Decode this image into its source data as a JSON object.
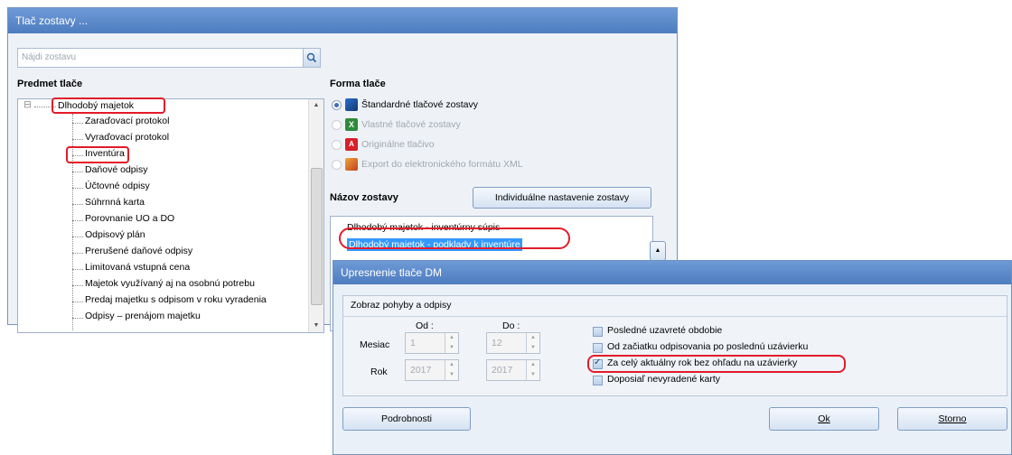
{
  "window": {
    "title": "Tlač zostavy ..."
  },
  "search": {
    "placeholder": "Nájdi zostavu"
  },
  "tree": {
    "header": "Predmet tlače",
    "root": "Dlhodobý majetok",
    "items": [
      "Zaraďovací protokol",
      "Vyraďovací protokol",
      "Inventúra",
      "Daňové odpisy",
      "Účtovné odpisy",
      "Súhrnná karta",
      "Porovnanie UO a DO",
      "Odpisový plán",
      "Prerušené daňové odpisy",
      "Limitovaná vstupná cena",
      "Majetok využívaný aj na osobnú potrebu",
      "Predaj majetku s odpisom v roku vyradenia",
      "Odpisy – prenájom majetku"
    ]
  },
  "forma": {
    "header": "Forma tlače",
    "options": [
      {
        "label": "Štandardné tlačové zostavy",
        "selected": true,
        "enabled": true,
        "icon": "standard-report-icon"
      },
      {
        "label": "Vlastné tlačové zostavy",
        "selected": false,
        "enabled": false,
        "icon": "excel-icon"
      },
      {
        "label": "Originálne tlačivo",
        "selected": false,
        "enabled": false,
        "icon": "pdf-icon"
      },
      {
        "label": "Export do elektronického formátu XML",
        "selected": false,
        "enabled": false,
        "icon": "xml-export-icon"
      }
    ]
  },
  "nazov": {
    "header": "Názov zostavy",
    "custom_button": "Individuálne nastavenie zostavy",
    "items": [
      "Dlhodobý majetok - inventúrny súpis",
      "Dlhodobý majetok - podklady k inventúre"
    ],
    "selected_index": 1
  },
  "dialog": {
    "title": "Upresnenie tlače DM",
    "group_title": "Zobraz pohyby a odpisy",
    "od_label": "Od :",
    "do_label": "Do :",
    "mesiac_label": "Mesiac",
    "rok_label": "Rok",
    "mesiac_od": "1",
    "mesiac_do": "12",
    "rok_od": "2017",
    "rok_do": "2017",
    "options": [
      {
        "label": "Posledné uzavreté obdobie",
        "checked": false
      },
      {
        "label": "Od začiatku odpisovania po poslednú uzávierku",
        "checked": false
      },
      {
        "label": "Za celý aktuálny rok bez ohľadu na uzávierky",
        "checked": true
      },
      {
        "label": "Doposiaľ nevyradené karty",
        "checked": false
      }
    ],
    "details_button": "Podrobnosti",
    "ok_button": "Ok",
    "cancel_button": "Storno"
  },
  "colors": {
    "highlight_red": "#e21b2a",
    "selection_blue": "#3399ff",
    "titlebar_blue": "#5b89cc"
  }
}
